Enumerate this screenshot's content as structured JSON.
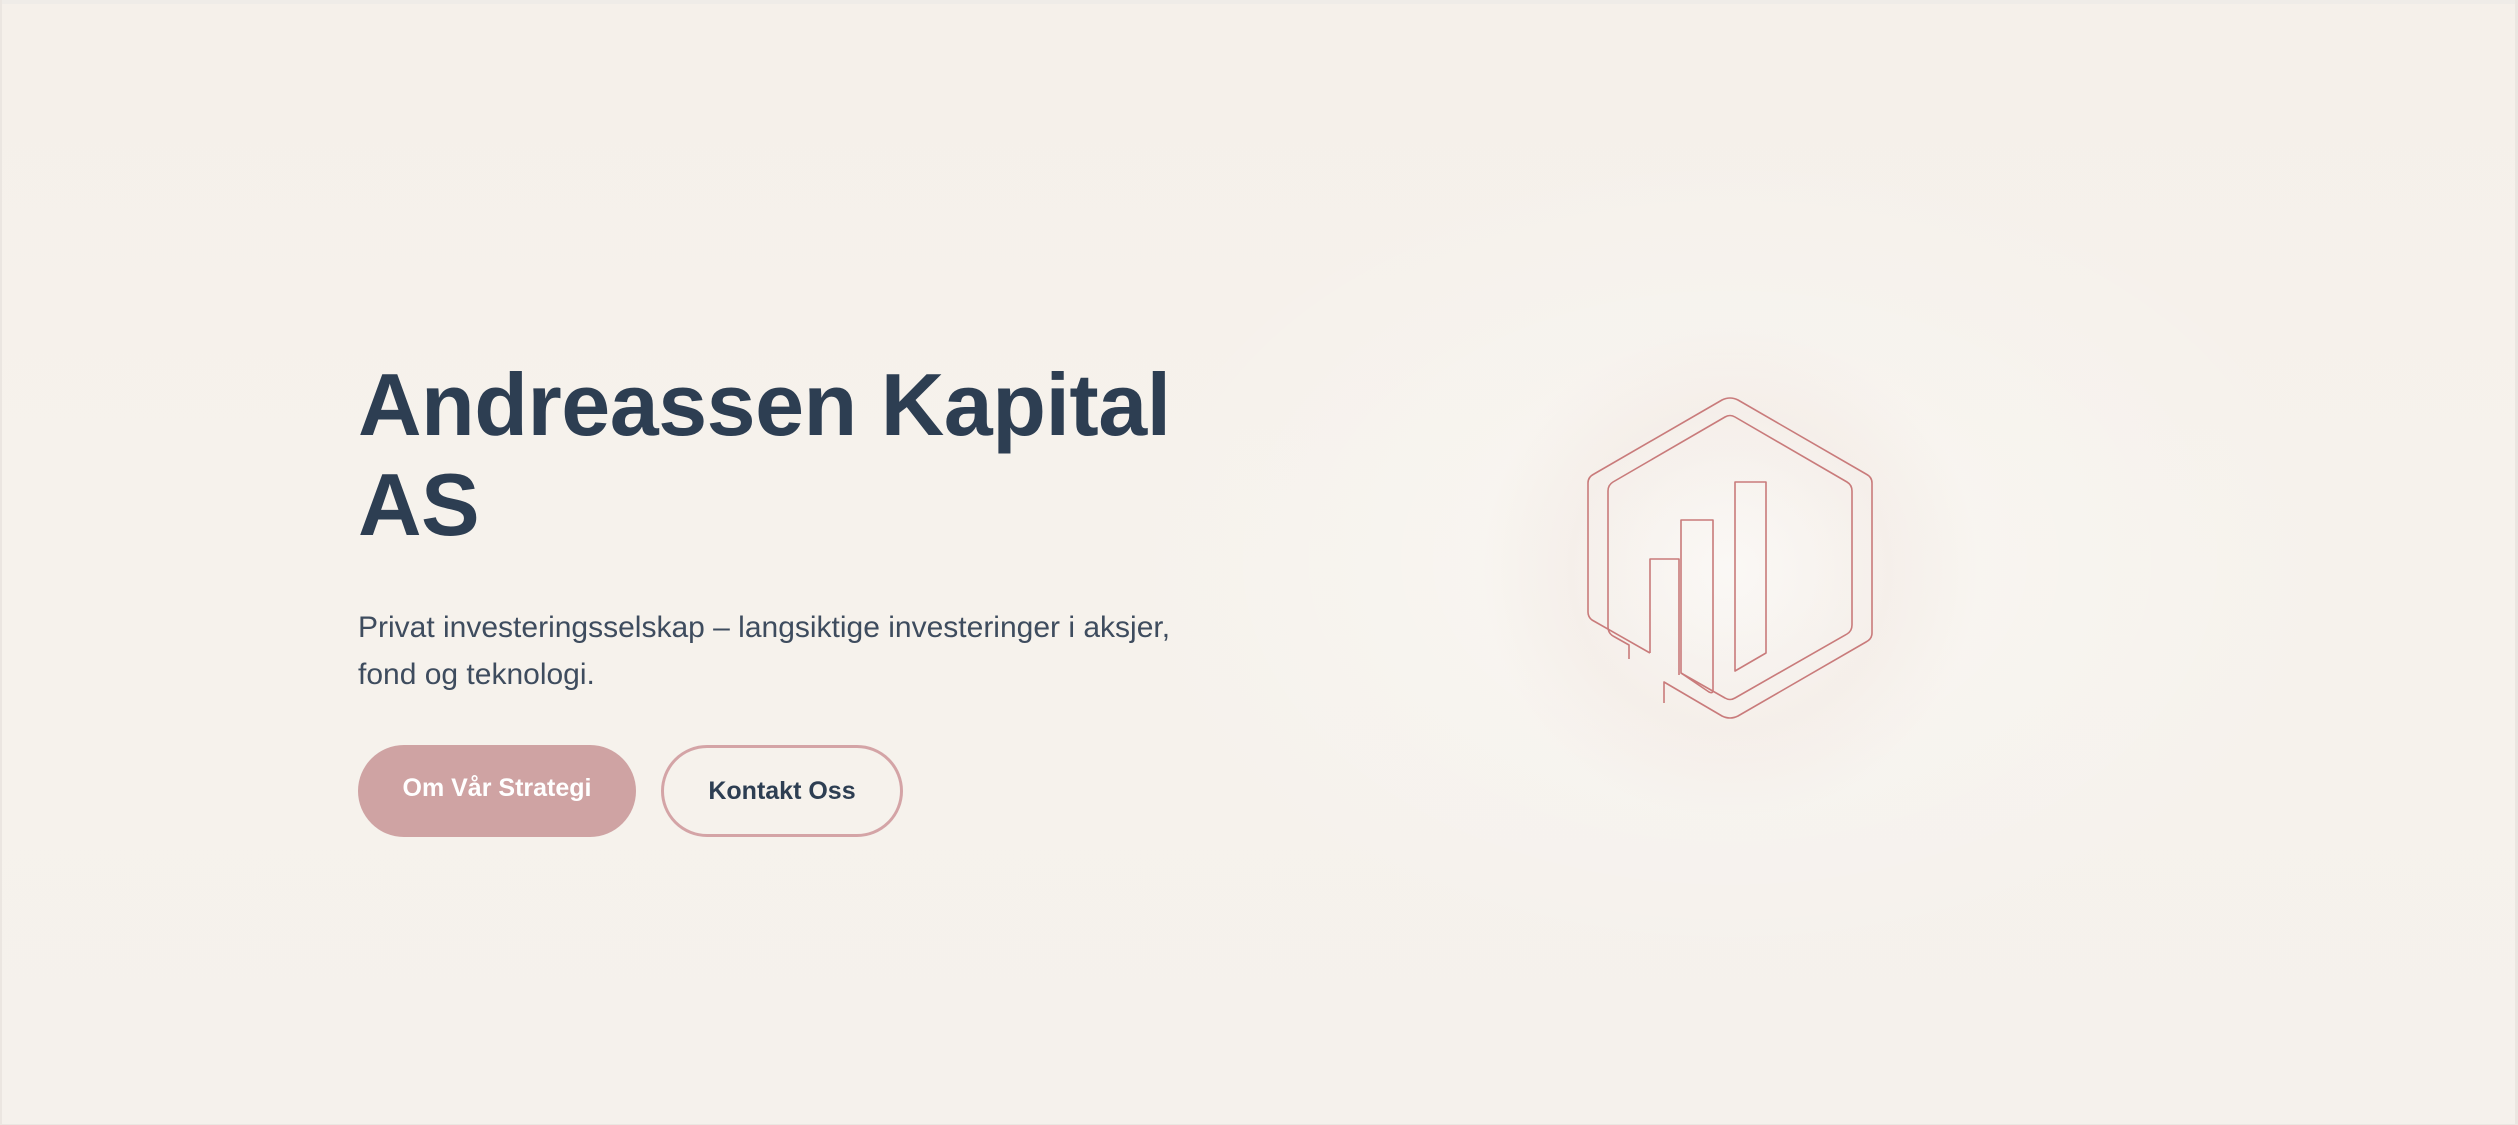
{
  "hero": {
    "title_line1": "Andreassen Kapital",
    "title_line2": "AS",
    "subtitle": "Privat investeringsselskap – langsiktige investeringer i aksjer, fond og teknologi.",
    "primary_button_label": "Om Vår Strategi",
    "secondary_button_label": "Kontakt Oss"
  },
  "logo": {
    "icon": "hexagon-bar-chart-icon",
    "stroke_color": "#c97b7b"
  },
  "colors": {
    "background": "#f5f0ea",
    "heading": "#2d3e52",
    "body_text": "#3e4c5e",
    "primary_button": "#cfa3a3",
    "secondary_button_border": "#d4a4a6"
  }
}
